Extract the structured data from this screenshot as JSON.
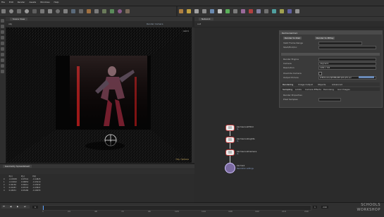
{
  "menubar": {
    "items": [
      "File",
      "Edit",
      "Render",
      "Assets",
      "Windows",
      "Help"
    ],
    "shelf_sets": [
      "Create",
      "Modify",
      "Model",
      "Polygon",
      "Deform",
      "Texture",
      "Rigging",
      "Characters",
      "Constraints",
      "Hair Utils",
      "Guide Process",
      "Terrain FX",
      "Cloud FX",
      "Volume"
    ],
    "tools": [
      "Box",
      "Sphere",
      "Tube",
      "Torus",
      "Grid",
      "Null",
      "Line",
      "Circle",
      "Curve",
      "Draw Curve",
      "Path",
      "Spray Paint",
      "Font",
      "Platonic Solids",
      "L-System",
      "Metaball",
      "File"
    ]
  },
  "viewport": {
    "tab": "Scene View",
    "camera_label": "Render Camera",
    "persp_label": "cam1",
    "path": "obj",
    "corner_label": "Hip / Sphere"
  },
  "network": {
    "tab": "Network",
    "path": "out",
    "nodes": [
      {
        "name": "karmacookHtml",
        "sub": "lq"
      },
      {
        "name": "karmacookLights",
        "sub": "lq"
      },
      {
        "name": "karmacookCamera",
        "sub": "lq"
      },
      {
        "name": "karma1",
        "sub": "Resolution settings"
      }
    ]
  },
  "parameters": {
    "title": "Karma karma1",
    "buttons": [
      "Render to Disk",
      "Render to MPlay"
    ],
    "labels": [
      "Valid Frame Range",
      "Start/End/Inc",
      "Render Engine",
      "Camera",
      "Resolution",
      "Override Camera",
      "Output Picture",
      "Render Properties",
      "Pixel Samples"
    ],
    "tabs": [
      "Rendering",
      "Image Output",
      "Objects",
      "Advanced"
    ],
    "subtabs": [
      "Sampling",
      "Limits",
      "Camera Effects",
      "Denoising",
      "Aux Images"
    ],
    "values": {
      "camera": "/obj/cam1",
      "resolution": "1280 x 720",
      "output": "$HIP/render/$HIPNAME.$OS.$F4.exr"
    }
  },
  "spreadsheet": {
    "tab": "Geometry Spreadsheet",
    "columns": [
      "",
      "P[x]",
      "P[y]",
      "P[z]"
    ],
    "rows": [
      [
        "0",
        "-0.03458",
        "0.97541",
        "-0.14825"
      ],
      [
        "1",
        "-0.01922",
        "0.96854",
        "-0.15210"
      ],
      [
        "2",
        "0.00156",
        "0.96211",
        "-0.15532"
      ],
      [
        "3",
        "0.02487",
        "0.95743",
        "-0.15847"
      ],
      [
        "4",
        "0.04631",
        "0.95186",
        "-0.16055"
      ]
    ]
  },
  "timeline": {
    "frame": "1",
    "start": "1",
    "end": "240",
    "ticks": [
      "1",
      "24",
      "48",
      "72",
      "96",
      "120",
      "144",
      "168",
      "192",
      "216",
      "240"
    ]
  },
  "watermark": {
    "line1": "SCHOOLS",
    "line2": "WORKSHOP"
  }
}
